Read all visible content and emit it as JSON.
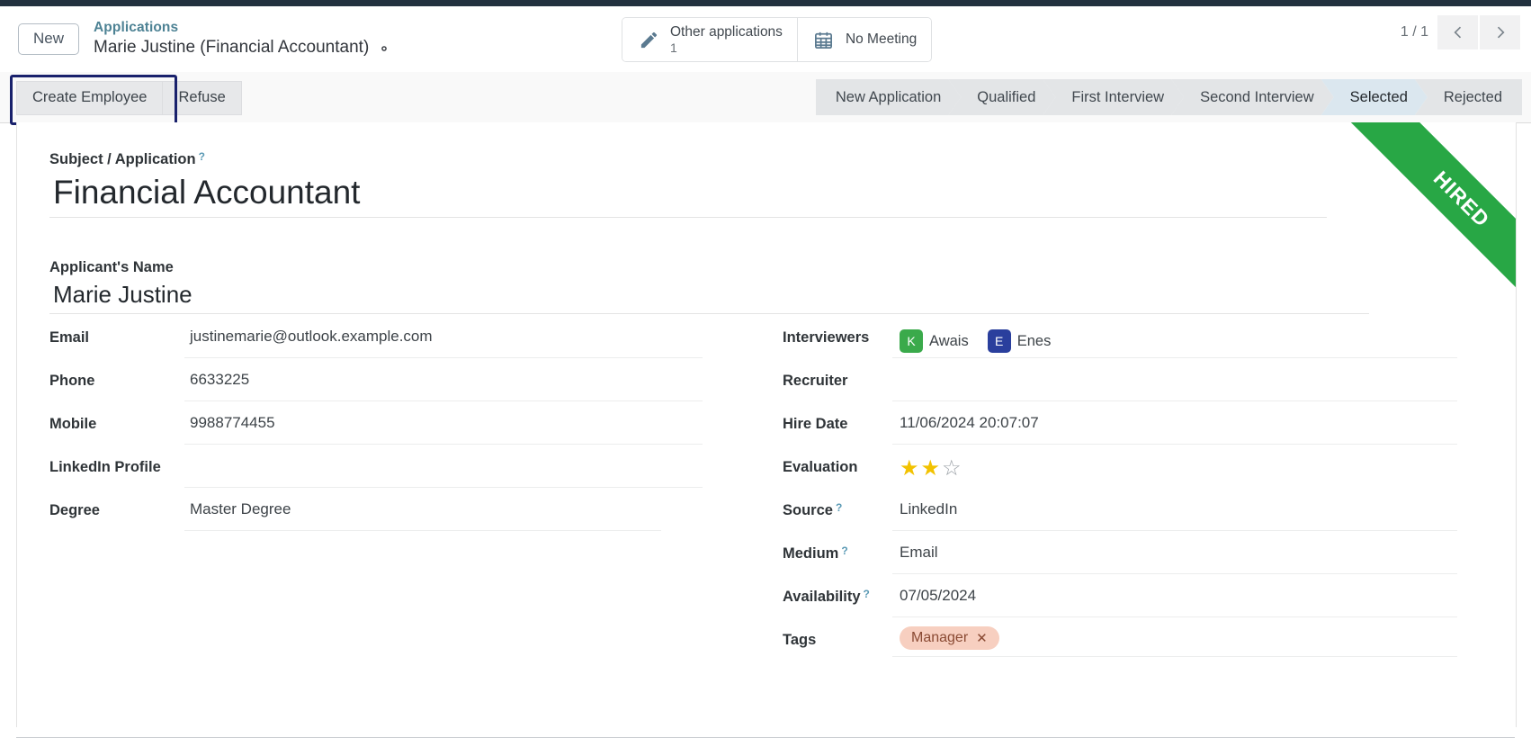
{
  "window": {
    "accent_dark": "#22313f"
  },
  "control_panel": {
    "new_button": "New",
    "breadcrumb_parent": "Applications",
    "breadcrumb_current": "Marie Justine (Financial Accountant)",
    "gear_icon": "gear-icon"
  },
  "stat_buttons": [
    {
      "icon": "pencil-icon",
      "label": "Other applications",
      "value": "1"
    },
    {
      "icon": "calendar-icon",
      "label": "No Meeting",
      "value": ""
    }
  ],
  "pager": {
    "count": "1 / 1",
    "prev_icon": "chevron-left-icon",
    "next_icon": "chevron-right-icon"
  },
  "actions": {
    "primary": "Create Employee",
    "secondary": "Refuse",
    "focused": "Create Employee"
  },
  "statusbar": {
    "stages": [
      "New Application",
      "Qualified",
      "First Interview",
      "Second Interview",
      "Selected",
      "Rejected"
    ],
    "active": "Selected",
    "active_color": "#dbe7ef"
  },
  "ribbon": {
    "text": "HIRED",
    "color": "#28a745"
  },
  "form": {
    "subject_label": "Subject / Application",
    "subject_value": "Financial Accountant",
    "applicant_label": "Applicant's Name",
    "applicant_value": "Marie Justine",
    "left_fields": [
      {
        "label": "Email",
        "value": "justinemarie@outlook.example.com",
        "tooltip": false
      },
      {
        "label": "Phone",
        "value": "6633225",
        "tooltip": false
      },
      {
        "label": "Mobile",
        "value": "9988774455",
        "tooltip": false
      },
      {
        "label": "LinkedIn Profile",
        "value": "",
        "tooltip": false
      },
      {
        "label": "Degree",
        "value": "Master Degree",
        "tooltip": false
      }
    ],
    "interviewers_label": "Interviewers",
    "interviewers": [
      {
        "initial": "K",
        "name": "Awais",
        "color": "#3aaa4b"
      },
      {
        "initial": "E",
        "name": "Enes",
        "color": "#2a3f9d"
      }
    ],
    "recruiter_label": "Recruiter",
    "recruiter_value": "",
    "hire_date_label": "Hire Date",
    "hire_date_value": "11/06/2024 20:07:07",
    "evaluation_label": "Evaluation",
    "evaluation_rating": 2,
    "evaluation_max": 3,
    "source_label": "Source",
    "source_value": "LinkedIn",
    "medium_label": "Medium",
    "medium_value": "Email",
    "availability_label": "Availability",
    "availability_value": "07/05/2024",
    "tags_label": "Tags",
    "tags": [
      {
        "name": "Manager",
        "color": "#f7cfc0",
        "text_color": "#8a4a33"
      }
    ]
  }
}
